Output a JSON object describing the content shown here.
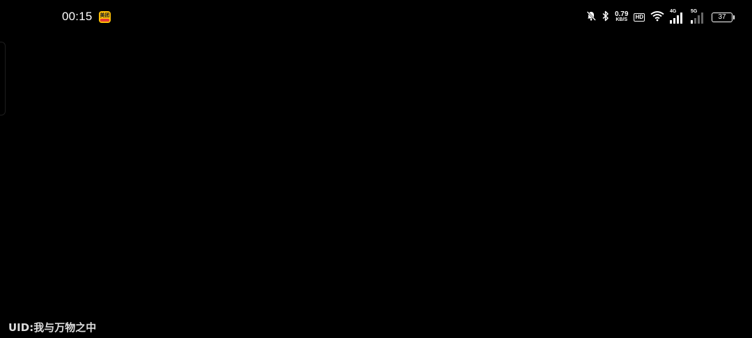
{
  "status_bar": {
    "time": "00:15",
    "app_badge_text": "美团",
    "network_speed_value": "0.79",
    "network_speed_unit": "KB/S",
    "hd_label": "HD",
    "net1_label": "4G",
    "net2_label": "5G",
    "battery_level": "37"
  },
  "footer": {
    "uid_text": "UID:我与万物之中"
  },
  "colors": {
    "background": "#000000",
    "foreground": "#ffffff",
    "badge_yellow": "#ffc107",
    "badge_red": "#e53935"
  },
  "icons": [
    "bell-off-icon",
    "bluetooth-icon",
    "wifi-icon",
    "signal-icon"
  ]
}
